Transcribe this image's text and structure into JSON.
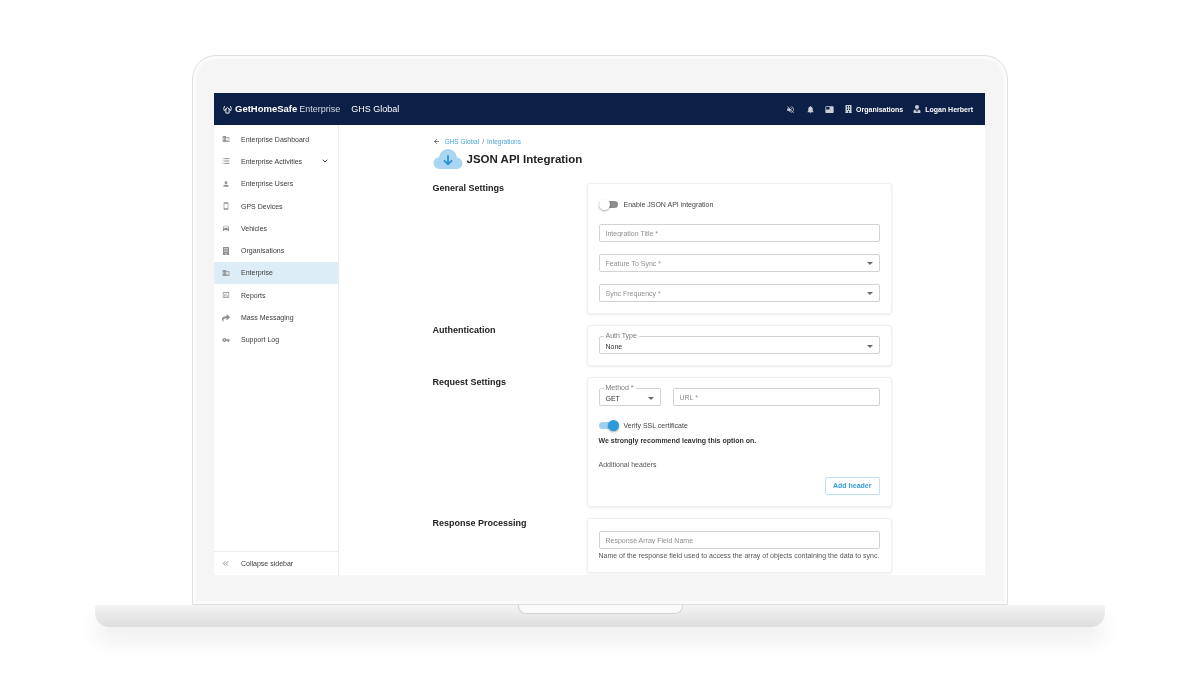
{
  "header": {
    "brand": "GetHomeSafe",
    "brand_suffix": "Enterprise",
    "workspace": "GHS Global",
    "organisations_link": "Organisations",
    "user_name": "Logan Herbert"
  },
  "sidebar": {
    "items": [
      {
        "label": "Enterprise Dashboard",
        "selected": false
      },
      {
        "label": "Enterprise Activities",
        "selected": false,
        "expanded": false
      },
      {
        "label": "Enterprise Users",
        "selected": false
      },
      {
        "label": "GPS Devices",
        "selected": false
      },
      {
        "label": "Vehicles",
        "selected": false
      },
      {
        "label": "Organisations",
        "selected": false
      },
      {
        "label": "Enterprise",
        "selected": true
      },
      {
        "label": "Reports",
        "selected": false
      },
      {
        "label": "Mass Messaging",
        "selected": false
      },
      {
        "label": "Support Log",
        "selected": false
      }
    ],
    "collapse_label": "Collapse sidebar"
  },
  "breadcrumb": {
    "items": [
      "GHS Global",
      "Integrations"
    ],
    "separator": "/"
  },
  "page_title": "JSON API Integration",
  "sections": [
    {
      "title": "General Settings",
      "fields": [
        {
          "kind": "toggle",
          "label": "Enable JSON API integration",
          "on": false
        },
        {
          "kind": "text",
          "placeholder": "Integration Title *"
        },
        {
          "kind": "select",
          "placeholder": "Feature To Sync *"
        },
        {
          "kind": "select",
          "placeholder": "Sync Frequency *"
        }
      ]
    },
    {
      "title": "Authentication",
      "fields": [
        {
          "kind": "select",
          "label": "Auth Type",
          "value": "None"
        }
      ]
    },
    {
      "title": "Request Settings",
      "fields": [
        {
          "kind": "row",
          "fields": [
            {
              "kind": "select",
              "label": "Method *",
              "value": "GET"
            },
            {
              "kind": "text",
              "placeholder": "URL *"
            }
          ]
        },
        {
          "kind": "toggle",
          "label": "Verify SSL certificate",
          "on": true
        },
        {
          "kind": "note",
          "text": "We strongly recommend leaving this option on."
        },
        {
          "kind": "caption",
          "text": "Additional headers"
        },
        {
          "kind": "button",
          "label": "Add header"
        }
      ]
    },
    {
      "title": "Response Processing",
      "fields": [
        {
          "kind": "text",
          "placeholder": "Response Array Field Name"
        },
        {
          "kind": "help",
          "text": "Name of the response field used to access the array of objects containing the data to sync."
        }
      ]
    }
  ]
}
